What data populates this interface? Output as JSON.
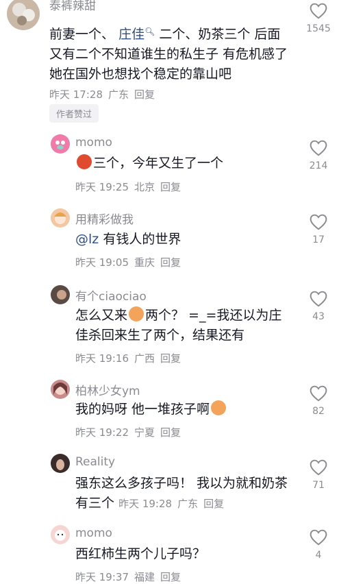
{
  "comments": [
    {
      "username": "泰裤辣甜",
      "text_before": "前妻一个、",
      "mention": "庄佳",
      "text_after": "二个、奶茶三个 后面又有二个不知道谁生的私生子 有危机感了 她在国外也想找个稳定的靠山吧",
      "time": "昨天 17:28",
      "location": "广东",
      "reply": "回复",
      "likes": "1545",
      "author_liked": "作者赞过",
      "avatar_color": "#c9b8a6"
    },
    {
      "username": "momo",
      "text_before": "",
      "text": "三个，今年又生了一个",
      "time": "昨天 19:25",
      "location": "北京",
      "reply": "回复",
      "likes": "214",
      "avatar_color": "#f07aa8"
    },
    {
      "username": "用精彩做我",
      "mention": "@lz",
      "text": "有钱人的世界",
      "time": "昨天 19:05",
      "location": "重庆",
      "reply": "回复",
      "likes": "17",
      "avatar_color": "#f4c7a3"
    },
    {
      "username": "有个ciaociao",
      "text_before": "怎么又来",
      "text_after": "两个？ =_=我还以为庄佳杀回来生了两个，结果还有",
      "time": "昨天 19:16",
      "location": "广西",
      "reply": "回复",
      "likes": "43",
      "avatar_color": "#5a4a44"
    },
    {
      "username": "柏林少女ym",
      "text": "我的妈呀 他一堆孩子啊",
      "time": "昨天 19:22",
      "location": "宁夏",
      "reply": "回复",
      "likes": "82",
      "avatar_color": "#c98b8b"
    },
    {
      "username": "Reality",
      "text": "强东这么多孩子吗！ 我以为就和奶茶有三个",
      "time": "昨天 19:28",
      "location": "广东",
      "reply": "回复",
      "likes": "71",
      "avatar_color": "#3a2c2a"
    },
    {
      "username": "momo",
      "text": "西红柿生两个儿子吗？",
      "time": "昨天 19:37",
      "location": "福建",
      "reply": "回复",
      "likes": "4",
      "avatar_color": "#f6d6d2"
    }
  ]
}
